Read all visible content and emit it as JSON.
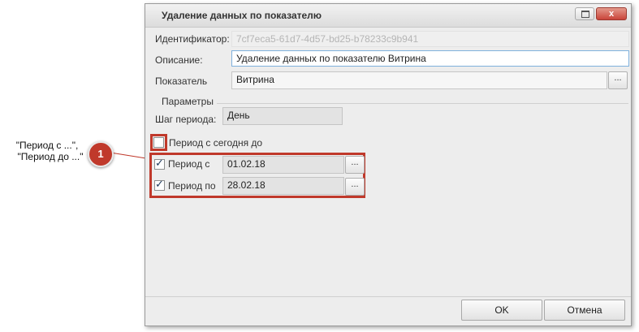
{
  "callout": {
    "line1": "\"Период с ...\",",
    "line2": "\"Период до ...\"",
    "badge": "1"
  },
  "window": {
    "title": "Удаление данных по показателю",
    "close_glyph": "x"
  },
  "form": {
    "id_label": "Идентификатор:",
    "id_value": "7cf7eca5-61d7-4d57-bd25-b78233c9b941",
    "desc_label": "Описание:",
    "desc_value": "Удаление данных по показателю Витрина",
    "indicator_label": "Показатель",
    "indicator_value": "Витрина",
    "browse_label": "...",
    "params_group": "Параметры",
    "step_label": "Шаг периода:",
    "step_value": "День",
    "today_label": "Период с сегодня до",
    "today_checked": false,
    "from_label": "Период с",
    "from_value": "01.02.18",
    "from_checked": true,
    "to_label": "Период по",
    "to_value": "28.02.18",
    "to_checked": true
  },
  "buttons": {
    "ok": "OK",
    "cancel": "Отмена"
  },
  "colors": {
    "highlight": "#c0392b",
    "badge": "#c0392b"
  }
}
